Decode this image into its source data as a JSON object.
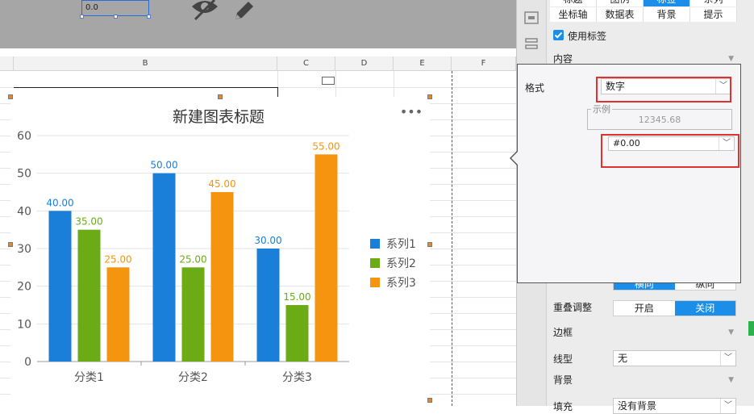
{
  "toolbar": {
    "textbox_value": "0.0",
    "icons": [
      "eye-off-icon",
      "pencil-icon"
    ]
  },
  "sheet": {
    "columns": [
      "B",
      "C",
      "D",
      "E",
      "F"
    ]
  },
  "chart_data": {
    "type": "bar",
    "title": "新建图表标题",
    "categories": [
      "分类1",
      "分类2",
      "分类3"
    ],
    "series": [
      {
        "name": "系列1",
        "values": [
          40,
          50,
          30
        ],
        "color": "#1a7fd8"
      },
      {
        "name": "系列2",
        "values": [
          35,
          25,
          15
        ],
        "color": "#6aab16"
      },
      {
        "name": "系列3",
        "values": [
          25,
          45,
          55
        ],
        "color": "#f5950f"
      }
    ],
    "ylim": [
      0,
      60
    ],
    "yticks": [
      0,
      10,
      20,
      30,
      40,
      50,
      60
    ],
    "data_label_format": "0.00",
    "legend": "right",
    "grid": true,
    "xlabel": "",
    "ylabel": "",
    "more_icon": "ellipsis-icon"
  },
  "panel": {
    "tabs_top": [
      "标题",
      "图例",
      "标签",
      "系列"
    ],
    "tabs_top_active": 2,
    "tabs_second": [
      "坐标轴",
      "数据表",
      "背景",
      "提示"
    ],
    "use_label_checkbox": "使用标签",
    "use_label_checked": true,
    "content_section": "内容",
    "overlap_label": "重叠调整",
    "overlap_options": [
      "开启",
      "关闭"
    ],
    "overlap_selected": 1,
    "direction_options": [
      "横向",
      "纵向"
    ],
    "direction_selected": 0,
    "border_section": "边框",
    "line_type_label": "线型",
    "line_type_value": "无",
    "background_section": "背景",
    "fill_label": "填充",
    "fill_value": "没有背景"
  },
  "popup": {
    "format_label": "格式",
    "format_value": "数字",
    "example_legend": "示例",
    "example_value": "12345.68",
    "pattern_value": "#0.00"
  }
}
